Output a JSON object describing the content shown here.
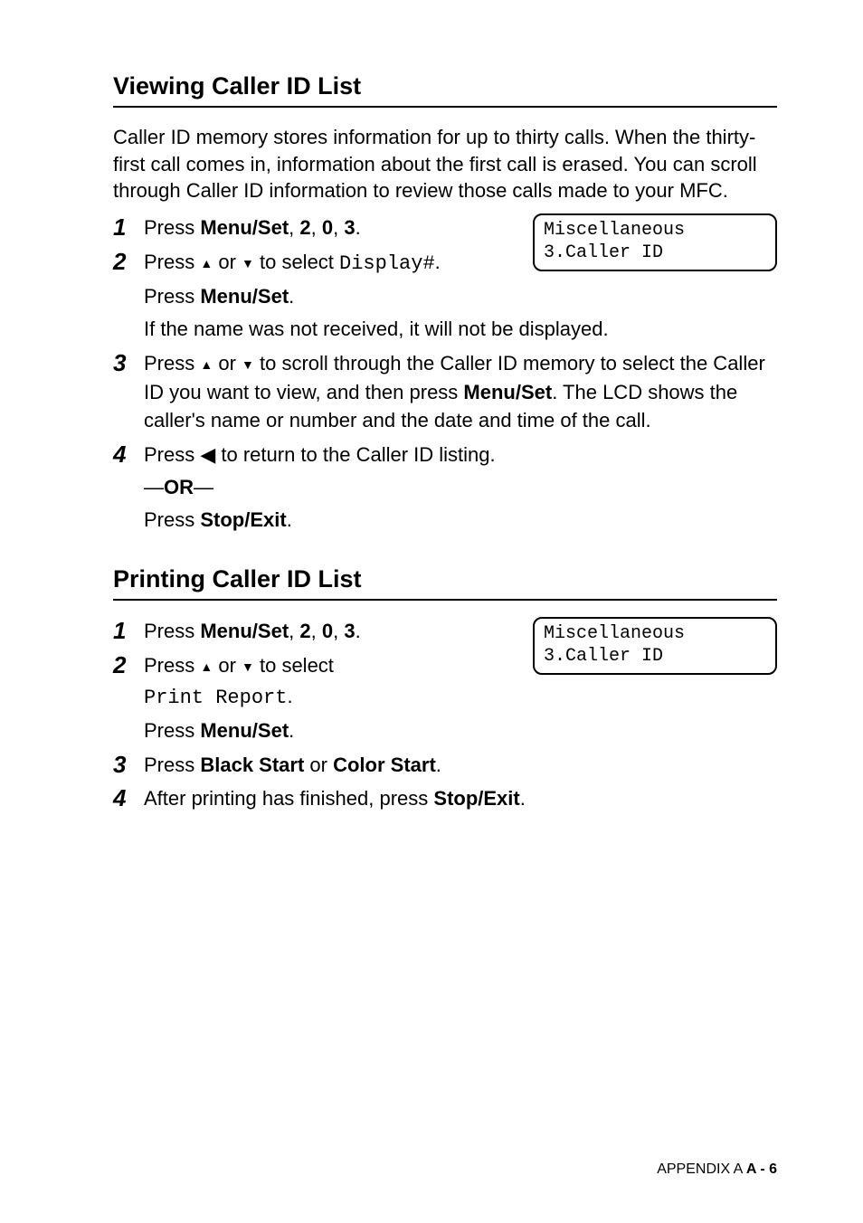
{
  "section1": {
    "title": "Viewing Caller ID List",
    "intro": "Caller ID memory stores information for up to thirty calls. When the thirty-first call comes in, information about the first call is erased. You can scroll through Caller ID information to review those calls made to your MFC.",
    "lcd": {
      "line1": "Miscellaneous",
      "line2": "3.Caller ID"
    },
    "step1": {
      "t1": "Press ",
      "b1": "Menu/Set",
      "t2": ", ",
      "b2": "2",
      "t3": ", ",
      "b3": "0",
      "t4": ", ",
      "b4": "3",
      "t5": "."
    },
    "step2": {
      "t1": "Press ",
      "t2": " or ",
      "t3": " to select ",
      "mono": "Display#",
      "t4": ".",
      "t5": "Press ",
      "b1": "Menu/Set",
      "t6": ".",
      "t7": "If the name was not received, it will not be displayed."
    },
    "step3": {
      "t1": "Press ",
      "t2": " or ",
      "t3": " to scroll through the Caller ID memory to select the Caller ID you want to view, and then press ",
      "b1": "Menu/Set",
      "t4": ". The LCD shows the caller's name or number and the date and time of the call."
    },
    "step4": {
      "t1": "Press  ",
      "t2": "  to return to the Caller ID listing.",
      "or1": "—",
      "orb": "OR",
      "or2": "—",
      "t3": "Press ",
      "b1": "Stop/Exit",
      "t4": "."
    }
  },
  "section2": {
    "title": "Printing Caller ID List",
    "lcd": {
      "line1": "Miscellaneous",
      "line2": "3.Caller ID"
    },
    "step1": {
      "t1": "Press ",
      "b1": "Menu/Set",
      "t2": ", ",
      "b2": "2",
      "t3": ", ",
      "b3": "0",
      "t4": ", ",
      "b4": "3",
      "t5": "."
    },
    "step2": {
      "t1": "Press ",
      "t2": " or ",
      "t3": " to select",
      "mono": "Print Report",
      "t4": ".",
      "t5": "Press ",
      "b1": "Menu/Set",
      "t6": "."
    },
    "step3": {
      "t1": "Press ",
      "b1": "Black Start",
      "t2": " or ",
      "b2": "Color Start",
      "t3": "."
    },
    "step4": {
      "t1": "After printing has finished, press ",
      "b1": "Stop/Exit",
      "t2": "."
    }
  },
  "footer": {
    "label": "APPENDIX A   ",
    "page": "A - 6"
  },
  "glyph": {
    "up": "▲",
    "down": "▼",
    "left": "◀"
  },
  "nums": {
    "n1": "1",
    "n2": "2",
    "n3": "3",
    "n4": "4"
  }
}
